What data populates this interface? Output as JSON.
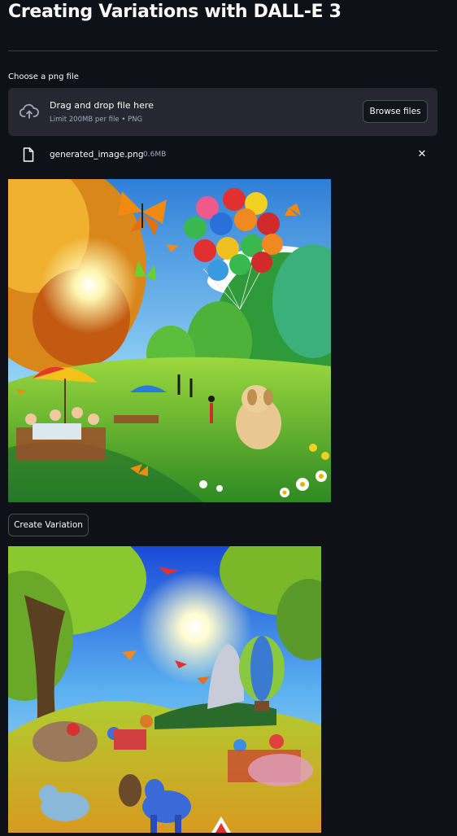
{
  "page": {
    "title": "Creating Variations with DALL-E 3",
    "background": "#0e1117"
  },
  "uploader": {
    "label": "Choose a png file",
    "drop_title": "Drag and drop file here",
    "drop_subtitle": "Limit 200MB per file • PNG",
    "browse_label": "Browse files",
    "upload_icon": "cloud-upload-icon"
  },
  "uploaded_file": {
    "name": "generated_image.png",
    "size": "0.6MB",
    "file_icon": "file-icon",
    "remove_icon": "close-icon",
    "remove_glyph": "✕"
  },
  "original_image": {
    "alt": "generated_image.png"
  },
  "actions": {
    "create_label": "Create Variation"
  },
  "variation_image": {
    "alt": "variation"
  },
  "colors": {
    "surface": "#262730",
    "border": "#4b4e58",
    "muted_text": "#a3a8b8",
    "text": "#fafafa"
  }
}
